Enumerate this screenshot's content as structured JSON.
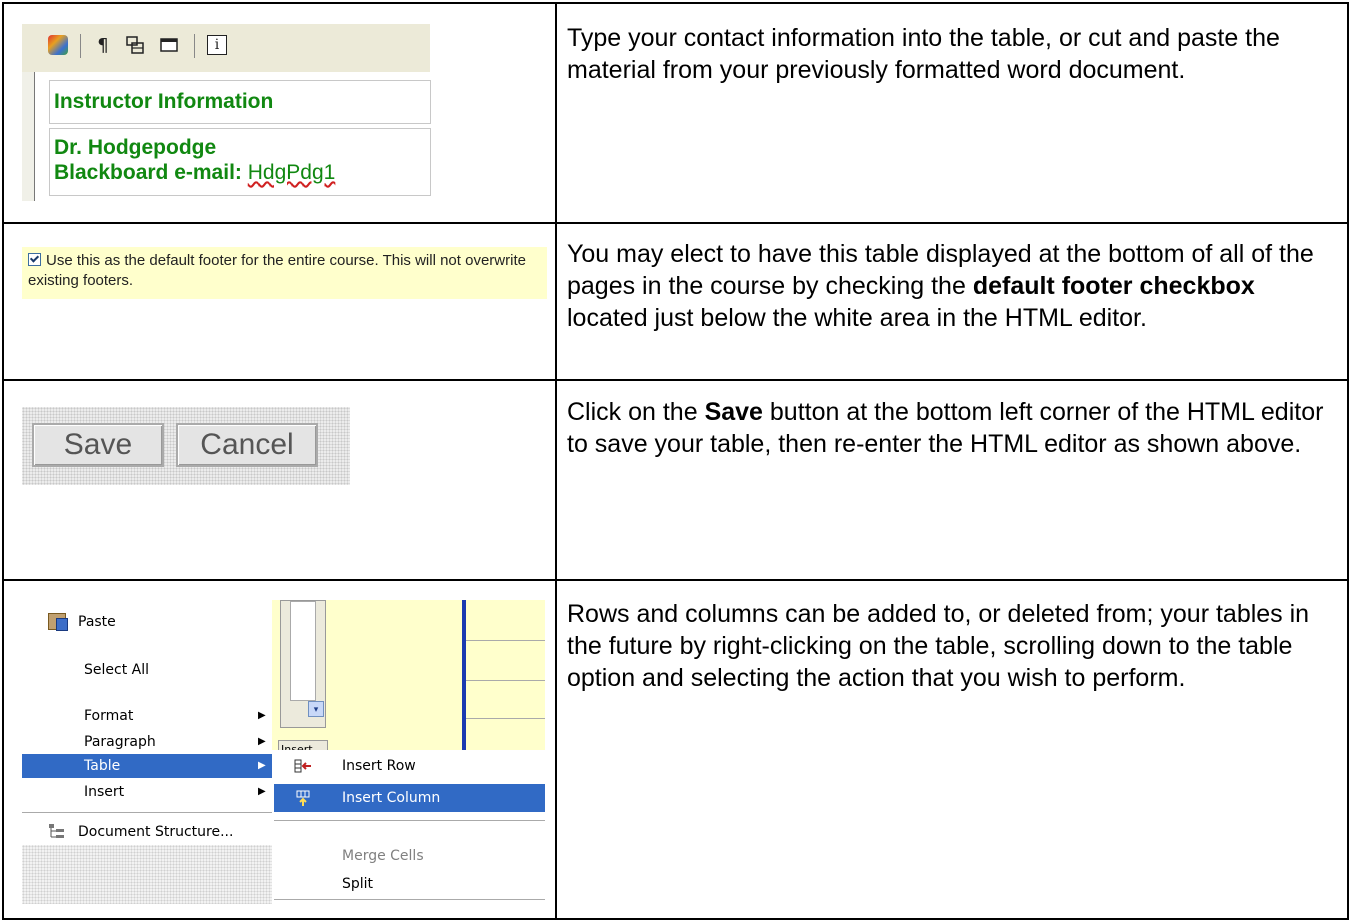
{
  "row1": {
    "editor": {
      "toolbar_icons": [
        "cube-icon",
        "pilcrow-icon",
        "table-icon",
        "box-icon",
        "info-icon"
      ],
      "pilcrow": "¶",
      "info": "i",
      "table_heading": "Instructor Information",
      "name": "Dr. Hodgepodge",
      "email_label": "Blackboard e-mail:",
      "email_value": "HdgPdg1"
    },
    "text": "Type your contact information into the table, or cut and paste the material from your previously formatted word document."
  },
  "row2": {
    "checkbox_label": "Use this as the default footer for the entire course. This will not overwrite existing footers.",
    "checkbox_checked": true,
    "text_before": "You may elect to have this table displayed at the bottom of all of the pages in the course by checking the ",
    "text_bold": "default footer checkbox",
    "text_after": " located just below the white area in the HTML editor."
  },
  "row3": {
    "save_label": "Save",
    "cancel_label": "Cancel",
    "text_before": "Click on the ",
    "text_bold": "Save",
    "text_after": " button at the bottom left corner of the HTML editor to save your table, then re-enter the HTML editor as shown above."
  },
  "row4": {
    "menu": {
      "paste": "Paste",
      "select_all": "Select All",
      "format": "Format",
      "paragraph": "Paragraph",
      "table": "Table",
      "insert": "Insert",
      "document_structure": "Document Structure...",
      "arrow": "▶"
    },
    "submenu": {
      "insert_row": "Insert Row",
      "insert_column": "Insert Column",
      "merge_cells": "Merge Cells",
      "split": "Split"
    },
    "toolbar_insert_label": "Insert",
    "dropdown_arrow": "▾",
    "text": "Rows and columns can be added to, or deleted from; your tables in the future by right-clicking on the table, scrolling down to the table option and selecting the action that you wish to perform."
  },
  "colors": {
    "editor_text_green": "#118811",
    "menu_highlight": "#316ac5",
    "footer_yellow": "#ffffcc"
  }
}
